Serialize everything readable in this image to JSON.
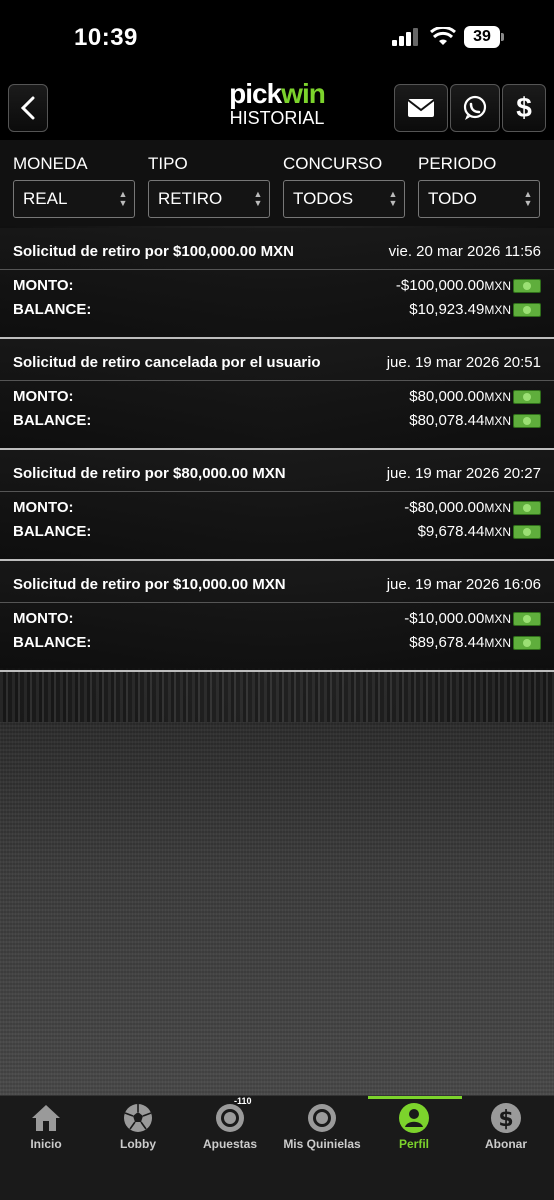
{
  "status": {
    "time": "10:39",
    "battery": "39"
  },
  "header": {
    "logo_a": "pick",
    "logo_b": "win",
    "subtitle": "HISTORIAL"
  },
  "filters": [
    {
      "label": "MONEDA",
      "value": "REAL"
    },
    {
      "label": "TIPO",
      "value": "RETIRO"
    },
    {
      "label": "CONCURSO",
      "value": "TODOS"
    },
    {
      "label": "PERIODO",
      "value": "TODO"
    }
  ],
  "transactions": [
    {
      "title": "Solicitud de retiro por $100,000.00 MXN",
      "date": "vie. 20 mar 2026 11:56",
      "monto_label": "MONTO:",
      "monto": "-$100,000.00",
      "balance_label": "BALANCE:",
      "balance": "$10,923.49",
      "currency": "MXN"
    },
    {
      "title": "Solicitud de retiro cancelada por el usuario",
      "date": "jue. 19 mar 2026 20:51",
      "monto_label": "MONTO:",
      "monto": "$80,000.00",
      "balance_label": "BALANCE:",
      "balance": "$80,078.44",
      "currency": "MXN"
    },
    {
      "title": "Solicitud de retiro por $80,000.00 MXN",
      "date": "jue. 19 mar 2026 20:27",
      "monto_label": "MONTO:",
      "monto": "-$80,000.00",
      "balance_label": "BALANCE:",
      "balance": "$9,678.44",
      "currency": "MXN"
    },
    {
      "title": "Solicitud de retiro por $10,000.00 MXN",
      "date": "jue. 19 mar 2026 16:06",
      "monto_label": "MONTO:",
      "monto": "-$10,000.00",
      "balance_label": "BALANCE:",
      "balance": "$89,678.44",
      "currency": "MXN"
    }
  ],
  "nav": {
    "items": [
      {
        "label": "Inicio",
        "icon": "home-icon"
      },
      {
        "label": "Lobby",
        "icon": "soccer-ball-icon"
      },
      {
        "label": "Apuestas",
        "icon": "target-icon",
        "badge": "-110"
      },
      {
        "label": "Mis Quinielas",
        "icon": "target-icon"
      },
      {
        "label": "Perfil",
        "icon": "user-icon",
        "active": true
      },
      {
        "label": "Abonar",
        "icon": "dollar-icon"
      }
    ]
  },
  "colors": {
    "accent": "#7cd32c",
    "money": "#5fae3c"
  }
}
